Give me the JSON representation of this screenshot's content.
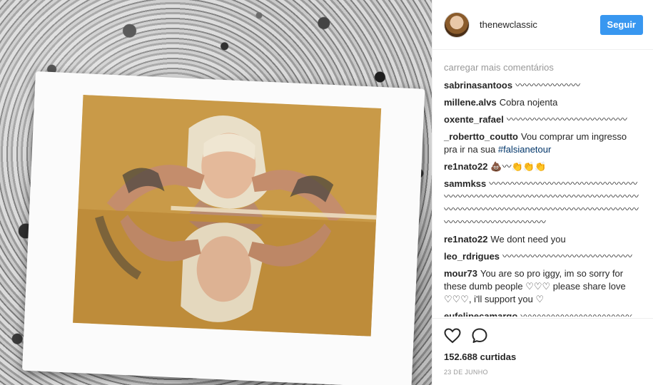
{
  "post": {
    "image_alt": "",
    "likes_label": "152.688 curtidas",
    "date": "23 DE JUNHO"
  },
  "header": {
    "username": "thenewclassic",
    "follow_label": "Seguir"
  },
  "comments": {
    "load_more": "carregar mais comentários",
    "items": [
      {
        "author": "sabrinasantoos",
        "text": "〰〰〰〰〰〰〰"
      },
      {
        "author": "millene.alvs",
        "text": "Cobra nojenta"
      },
      {
        "author": "oxente_rafael",
        "text": "〰〰〰〰〰〰〰〰〰〰〰〰〰"
      },
      {
        "author": "_robertto_coutto",
        "text": "Vou comprar um ingresso pra ir na sua",
        "hashtag": "#falsianetour"
      },
      {
        "author": "re1nato22",
        "text": "💩〰👏👏👏"
      },
      {
        "author": "sammkss",
        "text": "〰〰〰〰〰〰〰〰〰〰〰〰〰〰〰〰〰〰〰〰〰〰〰〰〰〰〰〰〰〰〰〰〰〰〰〰〰〰〰〰〰〰〰〰〰〰〰〰〰〰〰〰〰〰〰〰〰〰〰〰〰〰〰〰〰〰〰〰〰"
      },
      {
        "author": "re1nato22",
        "text": "We dont need you"
      },
      {
        "author": "leo_rdrigues",
        "text": "〰〰〰〰〰〰〰〰〰〰〰〰〰〰"
      },
      {
        "author": "mour73",
        "text": "You are so pro iggy, im so sorry for these dumb people ♡♡♡ please share love ♡♡♡, i'll support you ♡"
      },
      {
        "author": "eufelipecamargo",
        "text": "〰〰〰〰〰〰〰〰〰〰〰〰〰"
      }
    ]
  },
  "icons": {
    "like": "heart-icon",
    "comment": "speech-bubble-icon"
  },
  "colors": {
    "accent": "#3897f0",
    "hashtag": "#003569",
    "muted": "#999999"
  }
}
